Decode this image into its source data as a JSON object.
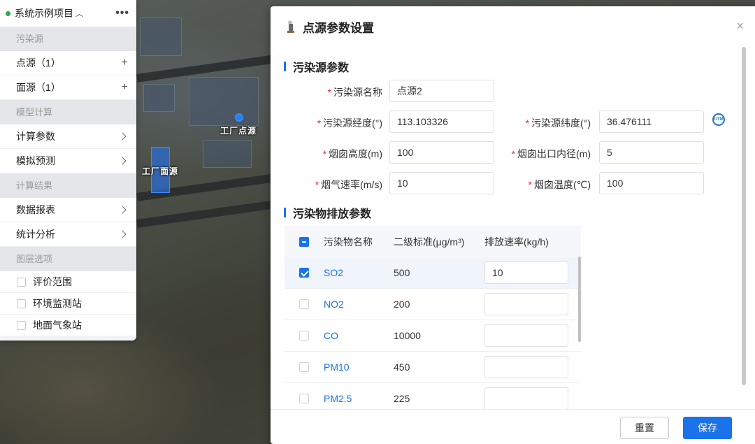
{
  "map": {
    "point_label": "工厂点源",
    "area_label": "工厂面源"
  },
  "sidebar": {
    "project_title": "系统示例项目",
    "project_caret": "︿",
    "more_icon": "•••",
    "sections": {
      "pollution": "污染源",
      "model": "模型计算",
      "results": "计算结果",
      "layers": "图层选项"
    },
    "items": {
      "point_source": "点源（1）",
      "area_source": "面源（1）",
      "calc_params": "计算参数",
      "simulation": "模拟预测",
      "data_report": "数据报表",
      "stats": "统计分析"
    },
    "add_icon": "+",
    "layers": [
      "评价范围",
      "环境监测站",
      "地面气象站"
    ]
  },
  "dialog": {
    "title": "点源参数设置",
    "close_icon": "×",
    "section1": "污染源参数",
    "section2": "污染物排放参数",
    "fields": {
      "name_label": "污染源名称",
      "name_value": "点源2",
      "lon_label": "污染源经度(°)",
      "lon_value": "113.103326",
      "lat_label": "污染源纬度(°)",
      "lat_value": "36.476111",
      "stack_h_label": "烟囱高度(m)",
      "stack_h_value": "100",
      "stack_d_label": "烟囱出口内径(m)",
      "stack_d_value": "5",
      "gas_v_label": "烟气速率(m/s)",
      "gas_v_value": "10",
      "stack_t_label": "烟囱温度(℃)",
      "stack_t_value": "100"
    },
    "utm_icon": "UTM",
    "table": {
      "headers": [
        "污染物名称",
        "二级标准(μg/m³)",
        "排放速率(kg/h)"
      ],
      "rows": [
        {
          "name": "SO2",
          "std": "500",
          "rate": "10",
          "checked": true
        },
        {
          "name": "NO2",
          "std": "200",
          "rate": "",
          "checked": false
        },
        {
          "name": "CO",
          "std": "10000",
          "rate": "",
          "checked": false
        },
        {
          "name": "PM10",
          "std": "450",
          "rate": "",
          "checked": false
        },
        {
          "name": "PM2.5",
          "std": "225",
          "rate": "",
          "checked": false
        }
      ]
    },
    "buttons": {
      "reset": "重置",
      "save": "保存"
    }
  },
  "colors": {
    "accent": "#1a73e8",
    "required": "#f5222d",
    "status_online": "#23b14d"
  }
}
